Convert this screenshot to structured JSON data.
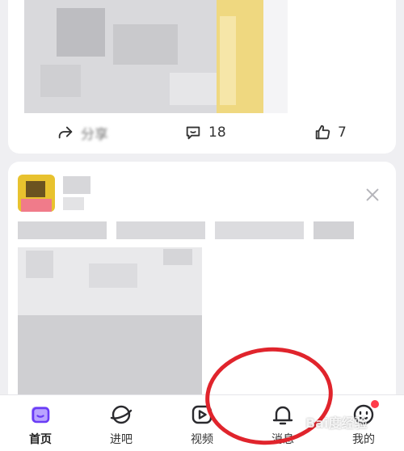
{
  "post1": {
    "share_label": "分享",
    "comment_count": "18",
    "like_count": "7"
  },
  "tabs": [
    {
      "label": "首页",
      "icon": "home-icon",
      "active": true
    },
    {
      "label": "进吧",
      "icon": "planet-icon",
      "active": false
    },
    {
      "label": "视频",
      "icon": "video-play-icon",
      "active": false
    },
    {
      "label": "消息",
      "icon": "bell-icon",
      "active": false
    },
    {
      "label": "我的",
      "icon": "profile-face-icon",
      "active": false
    }
  ],
  "watermark": "Bai度经验",
  "colors": {
    "accent": "#7b4bff",
    "notify": "#ff3b4a",
    "annotation": "#e0242c"
  }
}
